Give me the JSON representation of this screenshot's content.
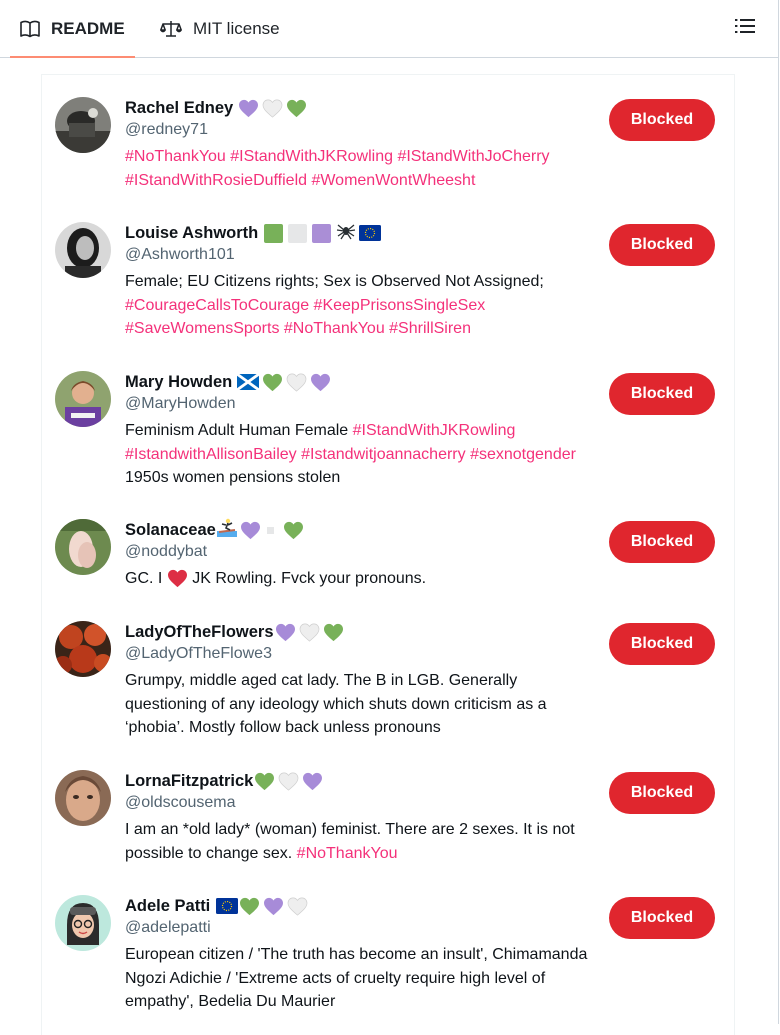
{
  "tabs": {
    "readme": "README",
    "license": "MIT license"
  },
  "colors": {
    "accent_hashtag": "#f4317a",
    "blocked_button": "#e0262e",
    "tab_underline": "#fd8c73"
  },
  "users": [
    {
      "name": "Rachel Edney",
      "handle": "@redney71",
      "bio": "#NoThankYou #IStandWithJKRowling #IStandWithJoCherry #IStandWithRosieDuffield #WomenWontWheesht",
      "button": "Blocked"
    },
    {
      "name": "Louise Ashworth",
      "handle": "@Ashworth101",
      "bio_text": "Female; EU Citizens rights; Sex is Observed Not Assigned;",
      "bio_tags": "#CourageCallsToCourage #KeepPrisonsSingleSex #SaveWomensSports #NoThankYou #ShrillSiren",
      "button": "Blocked"
    },
    {
      "name": "Mary Howden",
      "handle": "@MaryHowden",
      "bio_a": "Feminism Adult Human Female",
      "bio_tags": "#IStandWithJKRowling #IstandwithAllisonBailey #Istandwitjoannacherry #sexnotgender",
      "bio_b": "1950s women pensions stolen",
      "button": "Blocked"
    },
    {
      "name": "Solanaceae",
      "handle": "@noddybat",
      "bio_a": "GC. I",
      "bio_b": "JK Rowling. Fvck your pronouns.",
      "button": "Blocked"
    },
    {
      "name": "LadyOfTheFlowers",
      "handle": "@LadyOfTheFlowe3",
      "bio": "Grumpy, middle aged cat lady. The B in LGB. Generally questioning of any ideology which shuts down criticism as a ‘phobia’. Mostly follow back unless pronouns",
      "button": "Blocked"
    },
    {
      "name": "LornaFitzpatrick",
      "handle": "@oldscousema",
      "bio_text": "I am an *old lady* (woman) feminist. There are 2 sexes. It is not possible to change sex.",
      "bio_tag": "#NoThankYou",
      "button": "Blocked"
    },
    {
      "name": "Adele Patti",
      "handle": "@adelepatti",
      "bio": "European citizen / 'The truth has become an insult', Chimamanda Ngozi Adichie / 'Extreme acts of cruelty require high level of empathy', Bedelia Du Maurier",
      "button": "Blocked"
    }
  ]
}
